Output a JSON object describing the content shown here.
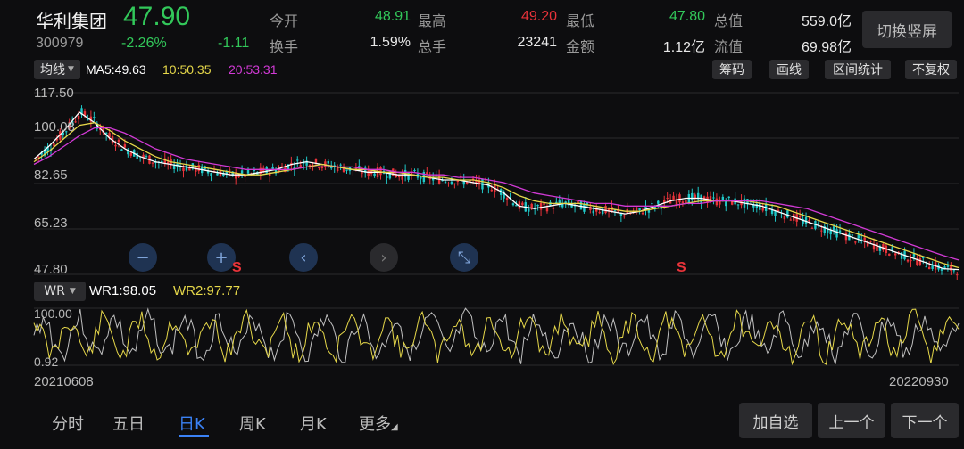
{
  "quote": {
    "name": "华利集团",
    "price": "47.90",
    "code": "300979",
    "pct_change": "-2.26%",
    "change": "-1.11",
    "stats": [
      {
        "label": "今开",
        "value": "48.91",
        "color": "#32c85a"
      },
      {
        "label": "最高",
        "value": "49.20",
        "color": "#e8333a"
      },
      {
        "label": "最低",
        "value": "47.80",
        "color": "#32c85a"
      },
      {
        "label": "总值",
        "value": "559.0亿",
        "color": "#e8e8e8"
      },
      {
        "label": "换手",
        "value": "1.59%",
        "color": "#e8e8e8"
      },
      {
        "label": "总手",
        "value": "23241",
        "color": "#e8e8e8"
      },
      {
        "label": "金额",
        "value": "1.12亿",
        "color": "#e8e8e8"
      },
      {
        "label": "流值",
        "value": "69.98亿",
        "color": "#e8e8e8"
      }
    ],
    "switch_label": "切换竖屏"
  },
  "indicators": {
    "line_selector": "均线",
    "ma5": "MA5:49.63",
    "ma10": "10:50.35",
    "ma20": "20:53.31",
    "buttons": [
      "筹码",
      "画线",
      "区间统计",
      "不复权"
    ]
  },
  "main_axis": [
    "117.50",
    "100.08",
    "82.65",
    "65.23",
    "47.80"
  ],
  "controls": {
    "zoom_out": "−",
    "zoom_in": "+",
    "prev": "‹",
    "next": "›",
    "collapse": "⤡"
  },
  "signals": [
    "S",
    "S"
  ],
  "wr": {
    "selector": "WR",
    "wr1": "WR1:98.05",
    "wr2": "WR2:97.77",
    "axis_top": "100.00",
    "axis_bottom": "0.92"
  },
  "dates": {
    "start": "20210608",
    "end": "20220930"
  },
  "tabs": [
    "分时",
    "五日",
    "日K",
    "周K",
    "月K",
    "更多"
  ],
  "active_tab": "日K",
  "actions": {
    "add": "加自选",
    "prev": "上一个",
    "next": "下一个"
  },
  "colors": {
    "up": "#e8333a",
    "down": "#32c85a",
    "ma5": "#ffffff",
    "ma10": "#e6d84a",
    "ma20": "#d23ad6",
    "accent": "#3b82f6"
  },
  "chart_data": {
    "type": "line",
    "y_range": [
      47.8,
      117.5
    ],
    "series": [
      {
        "name": "MA5",
        "values": [
          92,
          97,
          103,
          110,
          106,
          100,
          96,
          93,
          91,
          90,
          89,
          88,
          87,
          86,
          86,
          87,
          88,
          90,
          91,
          90,
          89,
          88,
          87,
          87,
          86,
          86,
          85,
          84,
          84,
          83,
          82,
          79,
          74,
          73,
          74,
          75,
          74,
          73,
          72,
          71,
          72,
          74,
          76,
          77,
          77,
          76,
          76,
          75,
          74,
          72,
          70,
          68,
          66,
          64,
          62,
          60,
          58,
          56,
          54,
          52,
          50,
          49.63
        ]
      },
      {
        "name": "10",
        "values": [
          91,
          95,
          100,
          105,
          106,
          103,
          99,
          96,
          93,
          91,
          90,
          89,
          88,
          87,
          86,
          86,
          87,
          88,
          89,
          90,
          89,
          88,
          88,
          87,
          87,
          86,
          85,
          85,
          84,
          84,
          83,
          81,
          78,
          76,
          75,
          75,
          75,
          74,
          73,
          72,
          72,
          73,
          74,
          75,
          76,
          76,
          76,
          76,
          75,
          74,
          72,
          70,
          68,
          66,
          64,
          62,
          60,
          58,
          56,
          54,
          52,
          50.35
        ]
      },
      {
        "name": "20",
        "values": [
          90,
          93,
          97,
          101,
          104,
          104,
          102,
          99,
          96,
          94,
          92,
          91,
          90,
          89,
          88,
          88,
          88,
          88,
          89,
          89,
          89,
          89,
          88,
          88,
          87,
          87,
          86,
          86,
          85,
          85,
          84,
          83,
          81,
          79,
          78,
          77,
          76,
          75,
          75,
          74,
          74,
          74,
          74,
          75,
          75,
          76,
          76,
          76,
          76,
          75,
          74,
          73,
          71,
          69,
          67,
          65,
          63,
          61,
          59,
          57,
          55,
          53.31
        ]
      }
    ]
  }
}
